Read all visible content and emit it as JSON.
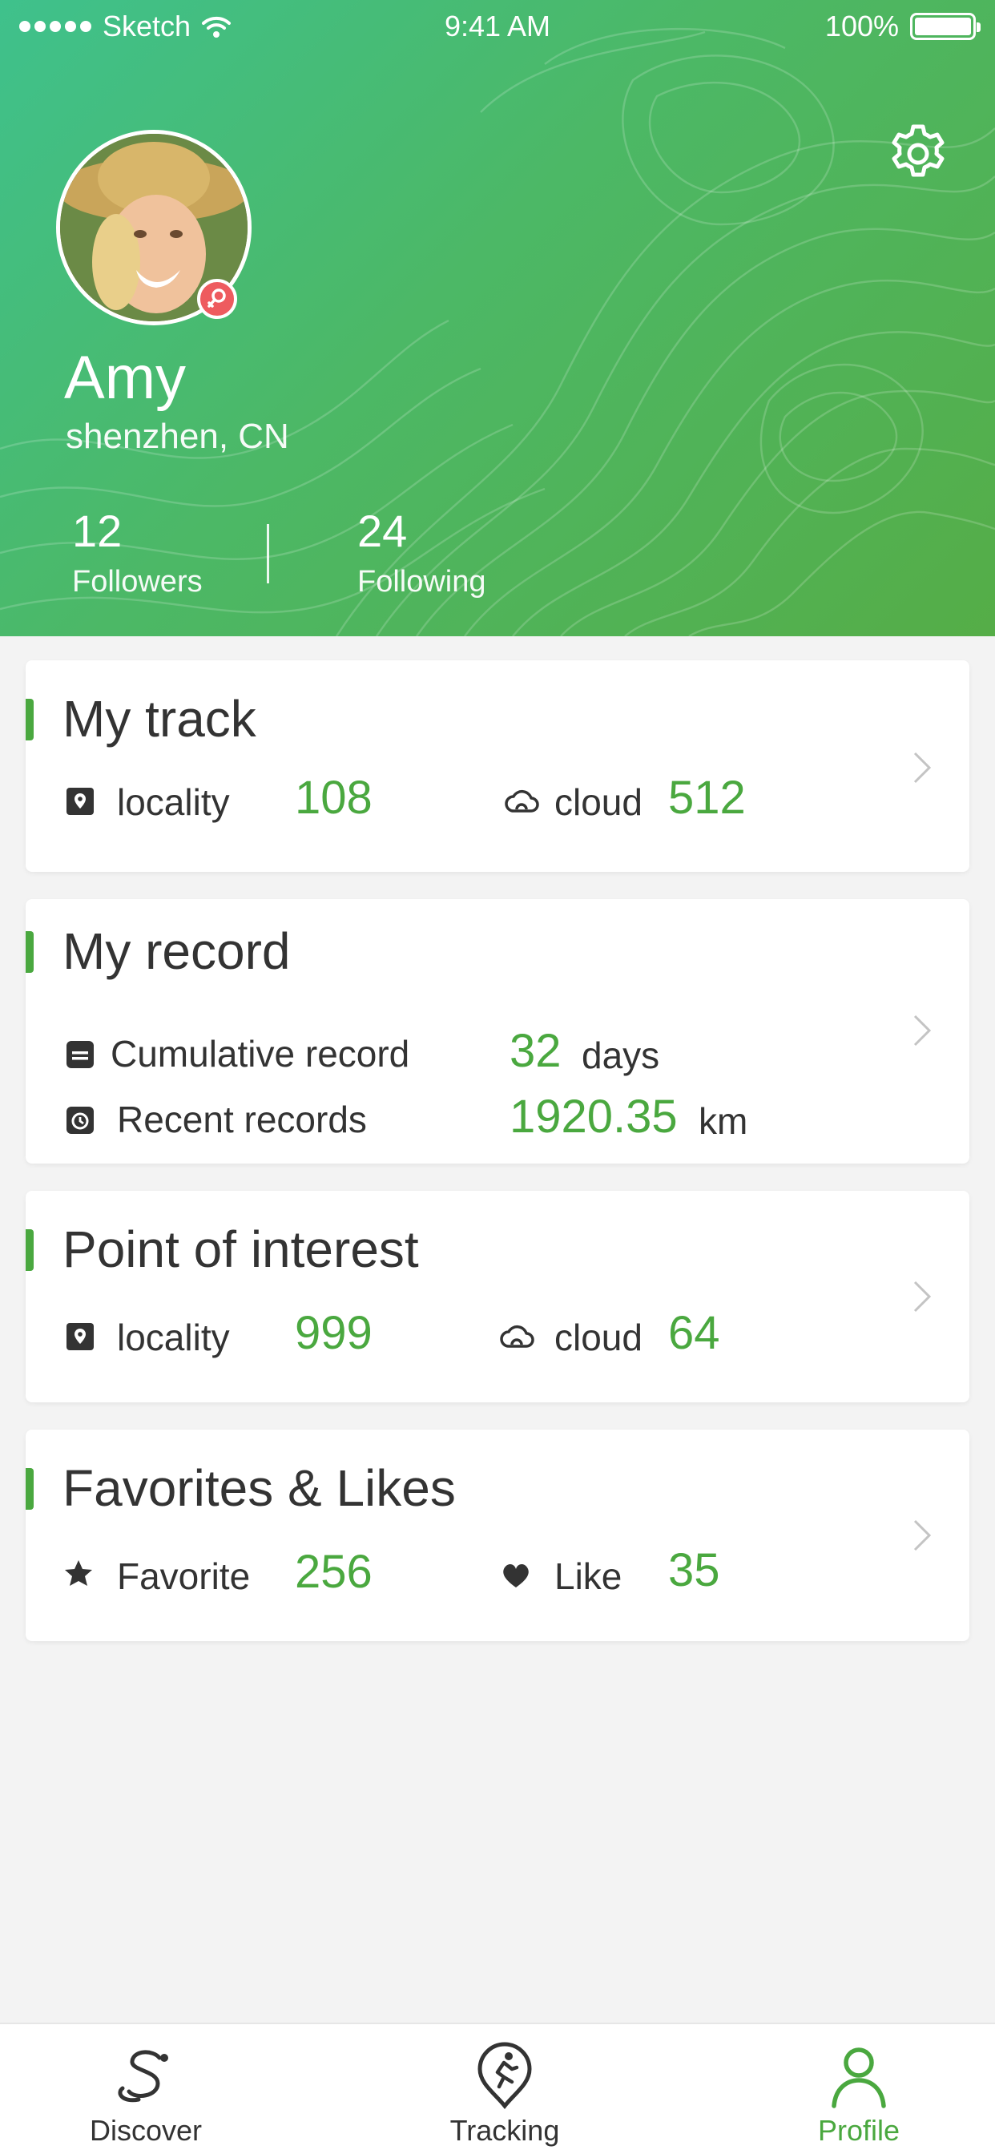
{
  "status_bar": {
    "carrier": "Sketch",
    "time": "9:41 AM",
    "battery": "100%"
  },
  "profile": {
    "name": "Amy",
    "location": "shenzhen, CN",
    "followers_count": "12",
    "followers_label": "Followers",
    "following_count": "24",
    "following_label": "Following"
  },
  "cards": {
    "track": {
      "title": "My track",
      "locality_label": "locality",
      "locality_value": "108",
      "cloud_label": "cloud",
      "cloud_value": "512"
    },
    "record": {
      "title": "My record",
      "cumulative_label": "Cumulative record",
      "cumulative_value": "32",
      "cumulative_unit": "days",
      "recent_label": "Recent records",
      "recent_value": "1920.35",
      "recent_unit": "km"
    },
    "poi": {
      "title": "Point of interest",
      "locality_label": "locality",
      "locality_value": "999",
      "cloud_label": "cloud",
      "cloud_value": "64"
    },
    "favorites": {
      "title": "Favorites & Likes",
      "favorite_label": "Favorite",
      "favorite_value": "256",
      "like_label": "Like",
      "like_value": "35"
    }
  },
  "tabbar": {
    "tabs": [
      {
        "label": "Discover",
        "icon": "discover-icon",
        "active": false
      },
      {
        "label": "Tracking",
        "icon": "tracking-icon",
        "active": false
      },
      {
        "label": "Profile",
        "icon": "profile-icon",
        "active": true
      }
    ]
  },
  "colors": {
    "accent": "#4aa83f",
    "header_gradient_start": "#3fc18c",
    "header_gradient_end": "#55ad47",
    "badge": "#ee5b5f",
    "background": "#f3f3f3"
  }
}
